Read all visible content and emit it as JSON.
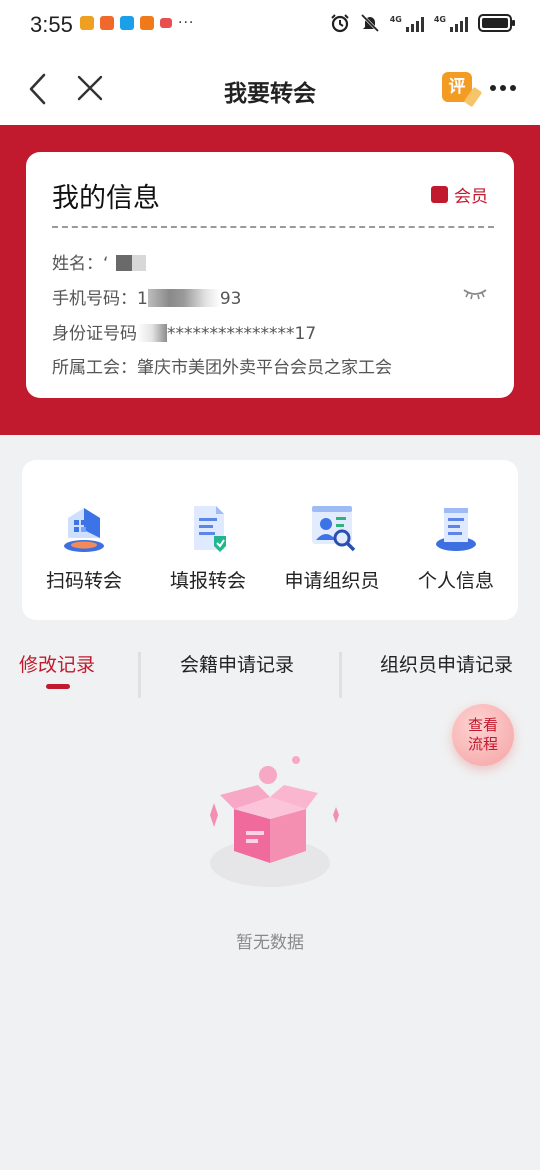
{
  "status_bar": {
    "time": "3:55",
    "notif_colors": [
      "#f0a020",
      "#f0692a",
      "#1aa0e8",
      "#f07a1a",
      "#e85050"
    ],
    "notif_more": "···",
    "icons": [
      "alarm-icon",
      "mute-icon",
      "signal-4g-icon",
      "signal-4g-icon",
      "battery-icon"
    ],
    "signal_label_1": "4G",
    "signal_label_2": "4G"
  },
  "header": {
    "title": "我要转会",
    "rate_icon_char": "评"
  },
  "info_card": {
    "title": "我的信息",
    "member_label": "会员",
    "name_label": "姓名：",
    "name_value": "‘",
    "phone_label": "手机号码：",
    "phone_prefix": "1",
    "phone_suffix": "93",
    "id_label": "身份证号码",
    "id_value": "***************17",
    "union_label": "所属工会：",
    "union_value": "肇庆市美团外卖平台会员之家工会"
  },
  "services": [
    {
      "label": "扫码转会",
      "icon": "scan-transfer-icon"
    },
    {
      "label": "填报转会",
      "icon": "form-transfer-icon"
    },
    {
      "label": "申请组织员",
      "icon": "apply-organizer-icon"
    },
    {
      "label": "个人信息",
      "icon": "personal-info-icon"
    }
  ],
  "tabs": [
    {
      "label": "修改记录",
      "active": true
    },
    {
      "label": "会籍申请记录",
      "active": false
    },
    {
      "label": "组织员申请记录",
      "active": false
    }
  ],
  "float_button": {
    "line1": "查看",
    "line2": "流程"
  },
  "empty_state": {
    "text": "暂无数据"
  },
  "colors": {
    "brand_red": "#c11a2e",
    "background": "#f0f1f2",
    "card": "#ffffff",
    "empty_box_pink": "#f48fb1"
  }
}
